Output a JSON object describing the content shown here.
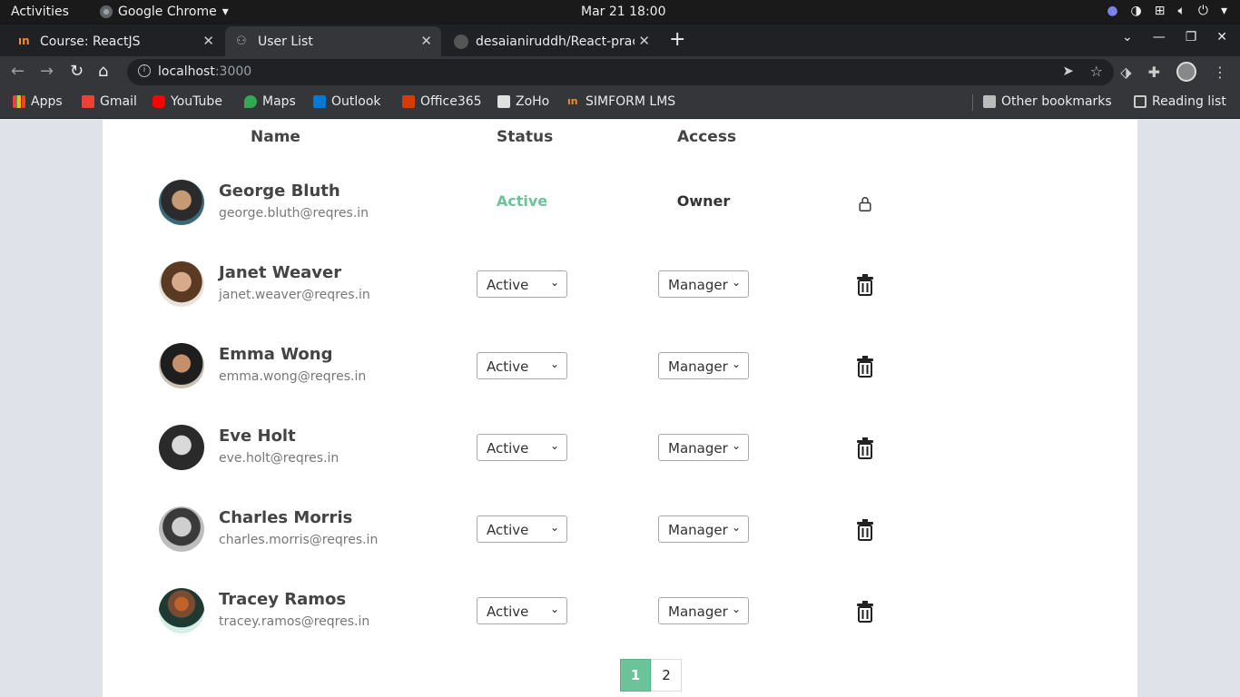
{
  "system": {
    "activities": "Activities",
    "app_name": "Google Chrome",
    "clock": "Mar 21  18:00"
  },
  "tabs": [
    {
      "title": "Course: ReactJS",
      "active": false
    },
    {
      "title": "User List",
      "active": true
    },
    {
      "title": "desaianiruddh/React-prac",
      "active": false
    }
  ],
  "address_bar": {
    "host": "localhost",
    "port": ":3000"
  },
  "bookmarks": [
    {
      "label": "Apps",
      "icon": "apps-grid-icon",
      "color": "#4285f4"
    },
    {
      "label": "Gmail",
      "icon": "gmail-icon",
      "color": "#ea4335"
    },
    {
      "label": "YouTube",
      "icon": "youtube-icon",
      "color": "#ff0000"
    },
    {
      "label": "Maps",
      "icon": "maps-icon",
      "color": "#34a853"
    },
    {
      "label": "Outlook",
      "icon": "outlook-icon",
      "color": "#0078d4"
    },
    {
      "label": "Office365",
      "icon": "office-icon",
      "color": "#d83b01"
    },
    {
      "label": "ZoHo",
      "icon": "zoho-icon",
      "color": "#e0e0e0"
    },
    {
      "label": "SIMFORM LMS",
      "icon": "simform-icon",
      "color": "#f28c28"
    }
  ],
  "bookmarks_right": {
    "other": "Other bookmarks",
    "reading": "Reading list"
  },
  "table": {
    "headers": {
      "name": "Name",
      "status": "Status",
      "access": "Access"
    },
    "users": [
      {
        "name": "George Bluth",
        "email": "george.bluth@reqres.in",
        "status": "Active",
        "access": "Owner",
        "owner": true
      },
      {
        "name": "Janet Weaver",
        "email": "janet.weaver@reqres.in",
        "status": "Active",
        "access": "Manager",
        "owner": false
      },
      {
        "name": "Emma Wong",
        "email": "emma.wong@reqres.in",
        "status": "Active",
        "access": "Manager",
        "owner": false
      },
      {
        "name": "Eve Holt",
        "email": "eve.holt@reqres.in",
        "status": "Active",
        "access": "Manager",
        "owner": false
      },
      {
        "name": "Charles Morris",
        "email": "charles.morris@reqres.in",
        "status": "Active",
        "access": "Manager",
        "owner": false
      },
      {
        "name": "Tracey Ramos",
        "email": "tracey.ramos@reqres.in",
        "status": "Active",
        "access": "Manager",
        "owner": false
      }
    ]
  },
  "pagination": {
    "pages": [
      "1",
      "2"
    ],
    "current": "1"
  },
  "colors": {
    "accent": "#6cc39a",
    "page_bg": "#dfe2e8"
  }
}
